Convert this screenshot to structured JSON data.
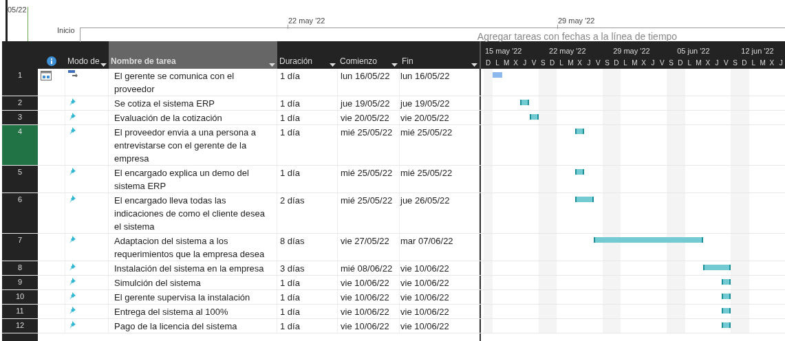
{
  "timeline": {
    "cut_date": "05/22",
    "start_label": "Inicio",
    "ticks": [
      "22 may '22",
      "29 may '22"
    ],
    "hint": "Agregar tareas con fechas a la línea de tiempo"
  },
  "columns": [
    {
      "kind": "number"
    },
    {
      "kind": "info"
    },
    {
      "kind": "mode",
      "label": "Modo de",
      "selected": false
    },
    {
      "kind": "name",
      "label": "Nombre de tarea",
      "selected": true
    },
    {
      "kind": "duration",
      "label": "Duración",
      "selected": false
    },
    {
      "kind": "start",
      "label": "Comienzo",
      "selected": false
    },
    {
      "kind": "finish",
      "label": "Fin",
      "selected": false
    }
  ],
  "gantt_weeks": [
    {
      "label": "15 may '22",
      "days": [
        "D",
        "L",
        "M",
        "X",
        "J",
        "V",
        "S"
      ]
    },
    {
      "label": "22 may '22",
      "days": [
        "D",
        "L",
        "M",
        "X",
        "J",
        "V",
        "S"
      ]
    },
    {
      "label": "29 may '22",
      "days": [
        "D",
        "L",
        "M",
        "X",
        "J",
        "V",
        "S"
      ]
    },
    {
      "label": "05 jun '22",
      "days": [
        "D",
        "L",
        "M",
        "X",
        "J",
        "V",
        "S"
      ]
    },
    {
      "label": "12 jun '22",
      "days": [
        "D",
        "L",
        "M",
        "X",
        "J"
      ]
    }
  ],
  "tasks": [
    {
      "id": "1",
      "kind": "auto",
      "calendar": true,
      "selected": false,
      "name": "El gerente se comunica con el proveedor",
      "duration": "1 día",
      "start": "lun 16/05/22",
      "finish": "lun 16/05/22"
    },
    {
      "id": "2",
      "kind": "manual",
      "calendar": false,
      "selected": false,
      "name": "Se cotiza el sistema ERP",
      "duration": "1 día",
      "start": "jue 19/05/22",
      "finish": "jue 19/05/22"
    },
    {
      "id": "3",
      "kind": "manual",
      "calendar": false,
      "selected": false,
      "name": "Evaluación de la cotización",
      "duration": "1 día",
      "start": "vie 20/05/22",
      "finish": "vie 20/05/22"
    },
    {
      "id": "4",
      "kind": "manual",
      "calendar": false,
      "selected": true,
      "name": "El proveedor envia a una persona a entrevistarse con el gerente de la empresa",
      "duration": "1 día",
      "start": "mié 25/05/22",
      "finish": "mié 25/05/22"
    },
    {
      "id": "5",
      "kind": "manual",
      "calendar": false,
      "selected": false,
      "name": "El encargado explica un demo del sistema ERP",
      "duration": "1 día",
      "start": "mié 25/05/22",
      "finish": "mié 25/05/22"
    },
    {
      "id": "6",
      "kind": "manual",
      "calendar": false,
      "selected": false,
      "name": "El encargado lleva todas las indicaciones de como el cliente desea el sistema",
      "duration": "2 días",
      "start": "mié 25/05/22",
      "finish": "jue 26/05/22"
    },
    {
      "id": "7",
      "kind": "manual",
      "calendar": false,
      "selected": false,
      "name": "Adaptacion del sistema a los requerimientos que la empresa desea",
      "duration": "8 días",
      "start": "vie 27/05/22",
      "finish": "mar 07/06/22"
    },
    {
      "id": "8",
      "kind": "manual",
      "calendar": false,
      "selected": false,
      "name": "Instalación del sistema en la empresa",
      "duration": "3 días",
      "start": "mié 08/06/22",
      "finish": "vie 10/06/22"
    },
    {
      "id": "9",
      "kind": "manual",
      "calendar": false,
      "selected": false,
      "name": "Simulción del sistema",
      "duration": "1 día",
      "start": "vie 10/06/22",
      "finish": "vie 10/06/22"
    },
    {
      "id": "10",
      "kind": "manual",
      "calendar": false,
      "selected": false,
      "name": "El gerente supervisa la instalación",
      "duration": "1 día",
      "start": "vie 10/06/22",
      "finish": "vie 10/06/22"
    },
    {
      "id": "11",
      "kind": "manual",
      "calendar": false,
      "selected": false,
      "name": "Entrega del sistema al 100%",
      "duration": "1 día",
      "start": "vie 10/06/22",
      "finish": "vie 10/06/22"
    },
    {
      "id": "12",
      "kind": "manual",
      "calendar": false,
      "selected": false,
      "name": "Pago de la licencia del sistema",
      "duration": "1 día",
      "start": "vie 10/06/22",
      "finish": "vie 10/06/22"
    }
  ]
}
